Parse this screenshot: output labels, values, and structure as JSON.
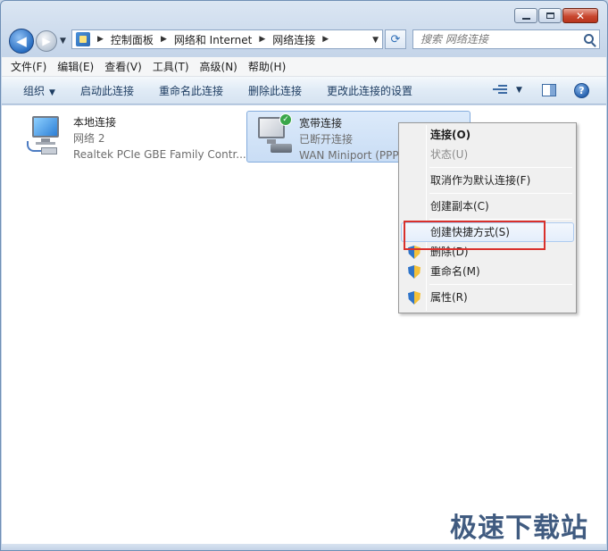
{
  "window": {
    "caption": {
      "minimize": "",
      "maximize": "",
      "close": "✕"
    }
  },
  "nav": {
    "address": [
      "控制面板",
      "网络和 Internet",
      "网络连接"
    ],
    "search_placeholder": "搜索 网络连接"
  },
  "menubar": [
    "文件(F)",
    "编辑(E)",
    "查看(V)",
    "工具(T)",
    "高级(N)",
    "帮助(H)"
  ],
  "commandbar": {
    "organize": "组织",
    "actions": [
      "启动此连接",
      "重命名此连接",
      "删除此连接",
      "更改此连接的设置"
    ]
  },
  "connections": [
    {
      "name": "本地连接",
      "status": "网络  2",
      "device": "Realtek PCIe GBE Family Contr..."
    },
    {
      "name": "宽带连接",
      "status": "已断开连接",
      "device": "WAN Miniport (PPP"
    }
  ],
  "context_menu": {
    "items": [
      {
        "label": "连接(O)",
        "style": "bold"
      },
      {
        "label": "状态(U)",
        "style": "disabled"
      },
      {
        "label": "取消作为默认连接(F)"
      },
      {
        "label": "创建副本(C)"
      },
      {
        "label": "创建快捷方式(S)",
        "style": "hover"
      },
      {
        "label": "删除(D)",
        "icon": "shield-icon"
      },
      {
        "label": "重命名(M)",
        "icon": "shield-icon"
      },
      {
        "label": "属性(R)",
        "icon": "shield-icon"
      }
    ]
  },
  "watermark": "极速下载站",
  "colors": {
    "highlight": "#d9302c",
    "accent": "#2f74c9"
  }
}
